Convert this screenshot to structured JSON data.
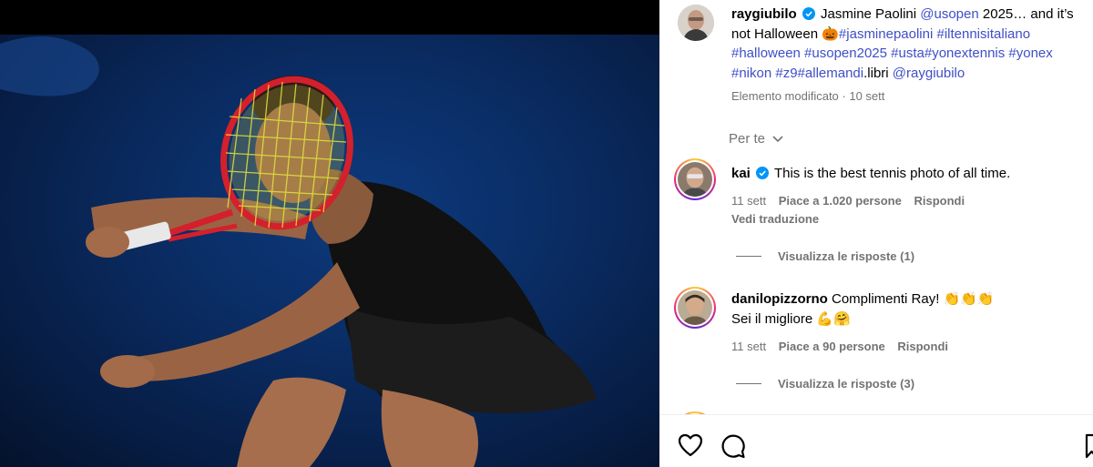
{
  "post": {
    "author": "raygiubilo",
    "caption_text": "Jasmine Paolini",
    "caption_mention1": "@usopen",
    "caption_mid": "2025… and it’s not Halloween",
    "caption_emoji": "🎃",
    "caption_tags": "#jasminepaolini #iltennisitaliano #halloween #usopen2025 #usta#yonextennis #yonex #nikon #z9#allemandi",
    "caption_tail": ".libri",
    "caption_mention2": "@raygiubilo",
    "edited_label": "Elemento modificato",
    "edited_time": "10 sett"
  },
  "sort": {
    "label": "Per te"
  },
  "comments": [
    {
      "user": "kai",
      "text": "This is the best tennis photo of all time.",
      "time": "11 sett",
      "likes": "Piace a 1.020 persone",
      "reply": "Rispondi",
      "translate": "Vedi traduzione",
      "view_replies": "Visualizza le risposte (1)"
    },
    {
      "user": "danilopizzorno",
      "text_line1": "Complimenti Ray! 👏👏👏",
      "text_line2": "Sei il migliore 💪🤗",
      "time": "11 sett",
      "likes": "Piace a 90 persone",
      "reply": "Rispondi",
      "view_replies": "Visualizza le risposte (3)"
    }
  ],
  "icons": {
    "verified": "verified-badge-icon",
    "like": "heart-icon",
    "comment": "comment-bubble-icon",
    "save": "bookmark-icon",
    "sort": "chevron-down-icon"
  },
  "colors": {
    "link": "#3e4fc7",
    "verified": "#0095f6",
    "muted": "#737373",
    "photo_bg": "#0a2c63",
    "racket_frame": "#d4202c"
  }
}
